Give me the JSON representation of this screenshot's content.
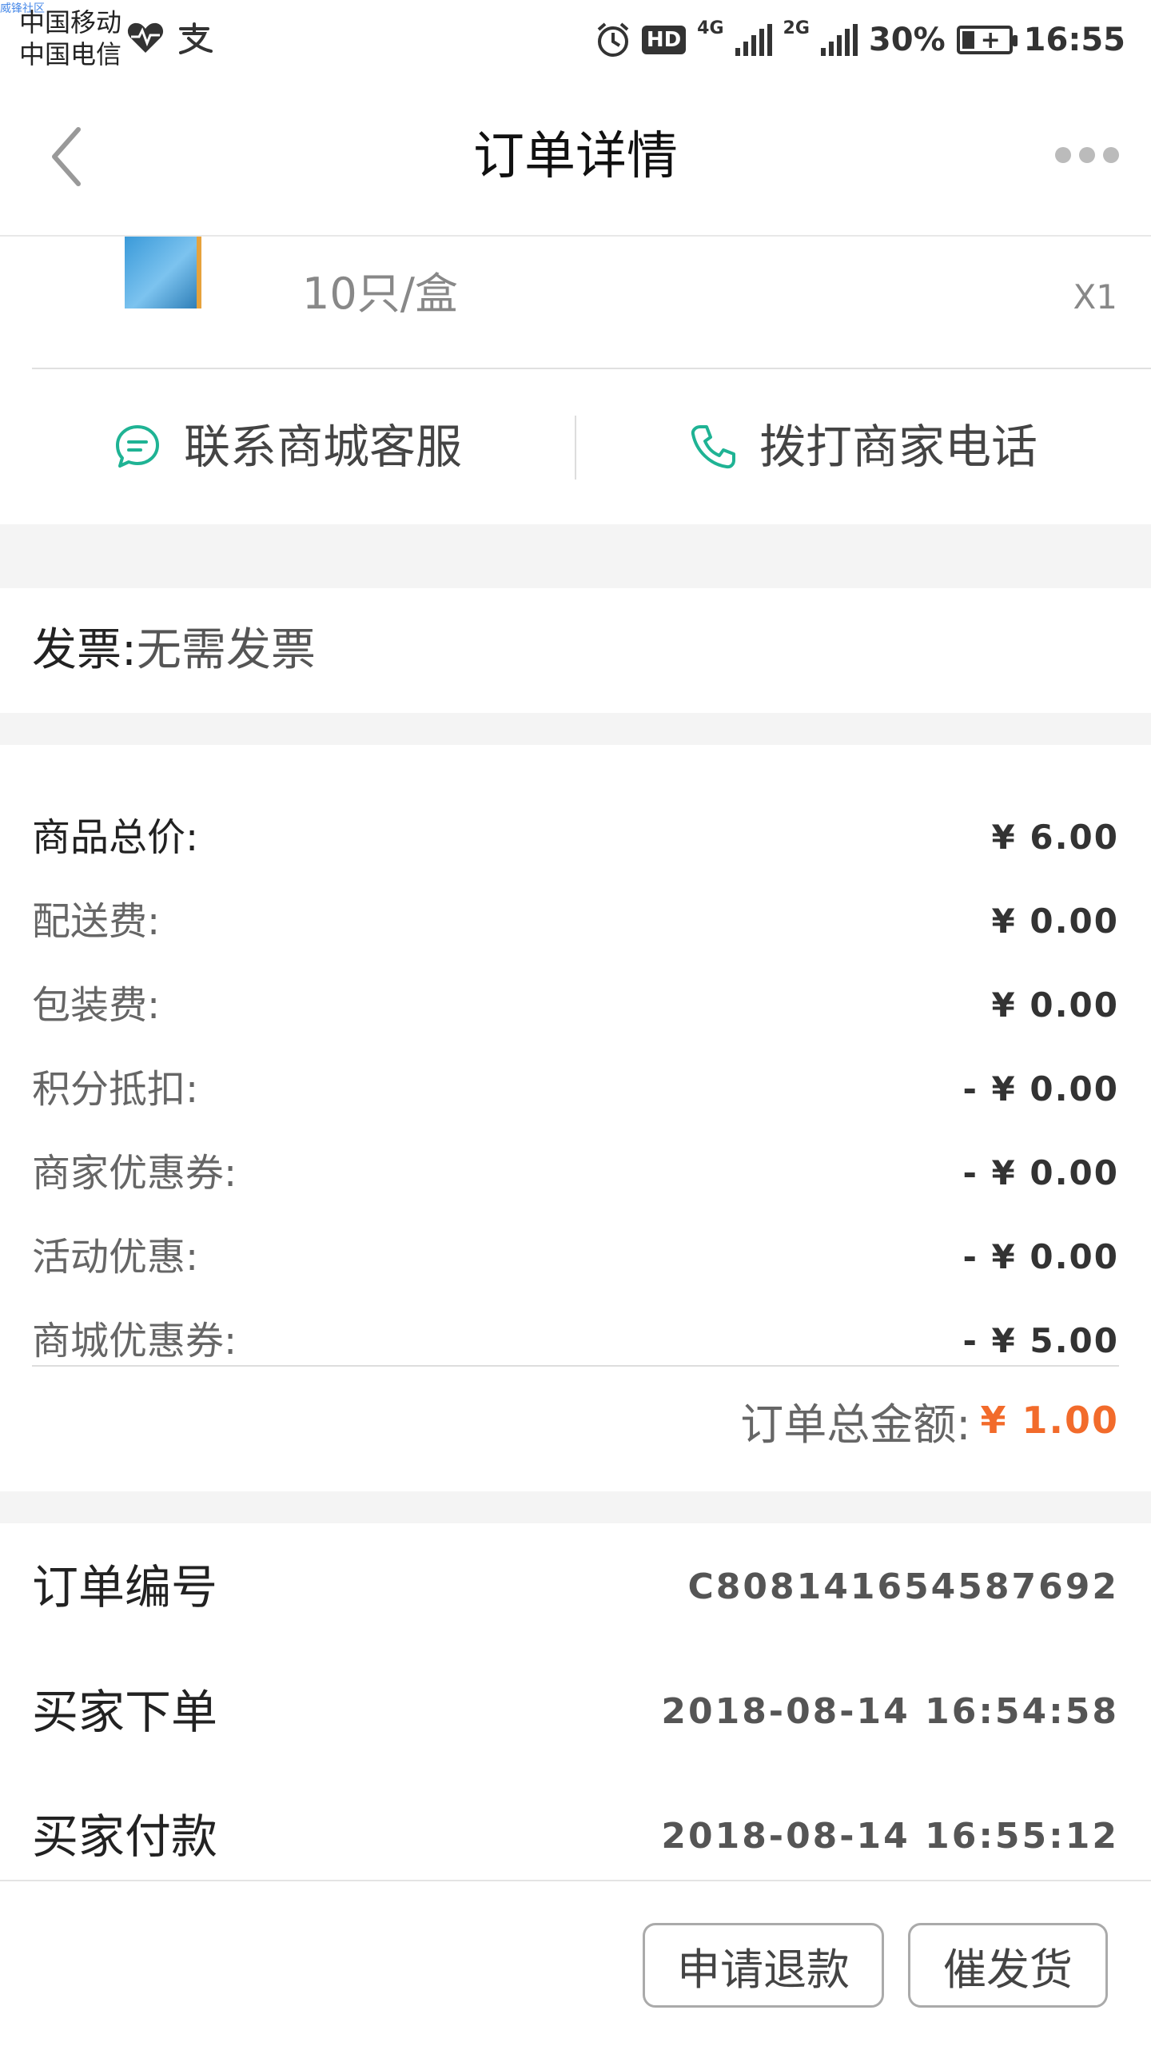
{
  "status_bar": {
    "watermark": "威锋社区",
    "carrier_1": "中国移动",
    "carrier_2": "中国电信",
    "hd": "HD",
    "net_1": "4G",
    "net_2": "2G",
    "battery": "30%",
    "time": "16:55",
    "icons": [
      "heart-pulse-icon",
      "alipay-icon",
      "alarm-icon",
      "signal-icon",
      "battery-charging-icon"
    ]
  },
  "nav": {
    "title": "订单详情",
    "back_icon": "chevron-left-icon",
    "more_icon": "more-dots-icon"
  },
  "product": {
    "spec": "10只/盒",
    "qty": "X1"
  },
  "contact": {
    "service_label": "联系商城客服",
    "phone_label": "拨打商家电话",
    "service_icon": "chat-bubble-icon",
    "phone_icon": "phone-icon",
    "accent_color": "#1fb394"
  },
  "invoice": {
    "label": "发票:",
    "value": "无需发票"
  },
  "fees": [
    {
      "label": "商品总价:",
      "value": "¥ 6.00"
    },
    {
      "label": "配送费:",
      "value": "¥ 0.00"
    },
    {
      "label": "包装费:",
      "value": "¥ 0.00"
    },
    {
      "label": "积分抵扣:",
      "value": "- ¥ 0.00"
    },
    {
      "label": "商家优惠券:",
      "value": "- ¥ 0.00"
    },
    {
      "label": "活动优惠:",
      "value": "- ¥ 0.00"
    },
    {
      "label": "商城优惠券:",
      "value": "- ¥ 5.00"
    }
  ],
  "total": {
    "label": "订单总金额:",
    "value": "¥ 1.00",
    "color": "#f26b2b"
  },
  "order_info": [
    {
      "label": "订单编号",
      "value": "C808141654587692"
    },
    {
      "label": "买家下单",
      "value": "2018-08-14 16:54:58"
    },
    {
      "label": "买家付款",
      "value": "2018-08-14 16:55:12"
    }
  ],
  "actions": {
    "refund": "申请退款",
    "urge": "催发货"
  }
}
